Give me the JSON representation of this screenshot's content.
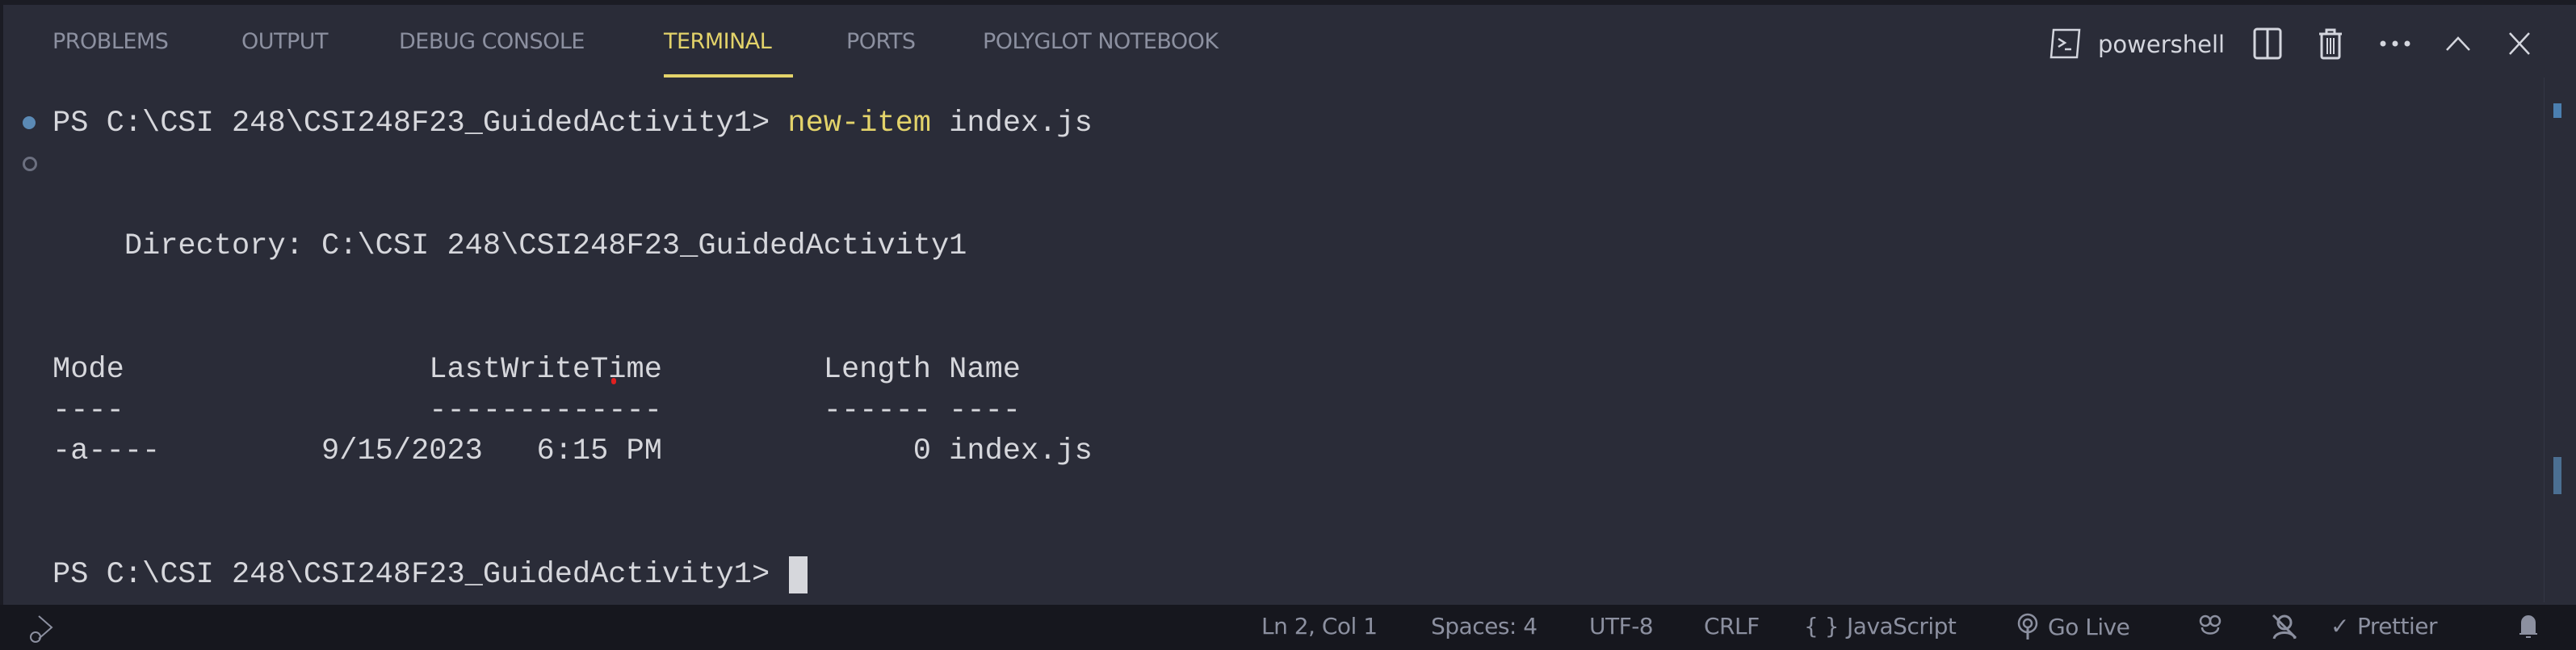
{
  "panel": {
    "tabs": [
      {
        "label": "PROBLEMS",
        "active": false
      },
      {
        "label": "OUTPUT",
        "active": false
      },
      {
        "label": "DEBUG CONSOLE",
        "active": false
      },
      {
        "label": "TERMINAL",
        "active": true
      },
      {
        "label": "PORTS",
        "active": false
      },
      {
        "label": "POLYGLOT NOTEBOOK",
        "active": false
      }
    ],
    "terminal_name": "powershell",
    "actions": [
      "split-terminal-icon",
      "trash-icon",
      "more-icon",
      "maximize-chevron-icon",
      "close-icon"
    ]
  },
  "terminal": {
    "prompt": "PS C:\\CSI 248\\CSI248F23_GuidedActivity1> ",
    "command": "new-item",
    "command_args": " index.js",
    "directory_line": "    Directory: C:\\CSI 248\\CSI248F23_GuidedActivity1",
    "header_line": "Mode                 LastWriteTime         Length Name",
    "rule_line": "----                 -------------         ------ ----",
    "row_line": "-a----         9/15/2023   6:15 PM              0 index.js",
    "final_prompt": "PS C:\\CSI 248\\CSI248F23_GuidedActivity1> "
  },
  "status_bar": {
    "position": "Ln 2, Col 1",
    "spaces": "Spaces: 4",
    "encoding": "UTF-8",
    "eol": "CRLF",
    "language": "JavaScript",
    "go_live": "Go Live",
    "prettier": "Prettier"
  },
  "colors": {
    "accent": "#e3d36a",
    "background": "#2a2c38",
    "status_bar": "#16171e",
    "decoration_blue": "#5b8ab5"
  }
}
